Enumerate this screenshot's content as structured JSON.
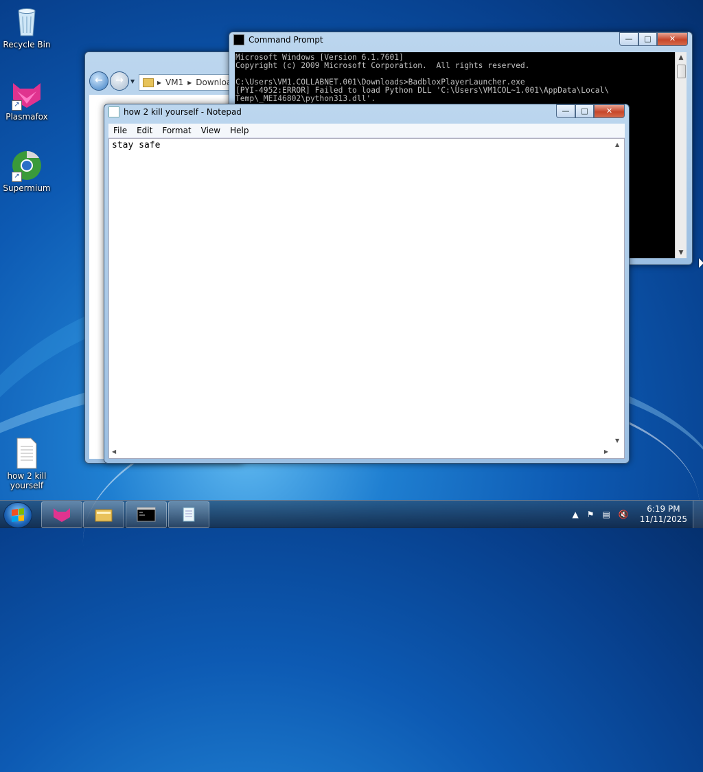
{
  "desktop": {
    "icons": [
      {
        "label": "Recycle Bin",
        "icon": "recycle-bin-icon"
      },
      {
        "label": "Plasmafox",
        "icon": "plasmafox-icon"
      },
      {
        "label": "Supermium",
        "icon": "supermium-icon"
      },
      {
        "label": "how 2 kill yourself",
        "icon": "text-file-icon"
      }
    ]
  },
  "cmd": {
    "title": "Command Prompt",
    "lines": [
      "Microsoft Windows [Version 6.1.7601]",
      "Copyright (c) 2009 Microsoft Corporation.  All rights reserved.",
      "",
      "C:\\Users\\VM1.COLLABNET.001\\Downloads>BadbloxPlayerLauncher.exe",
      "[PYI-4952:ERROR] Failed to load Python DLL 'C:\\Users\\VM1COL~1.001\\AppData\\Local\\",
      "Temp\\_MEI46802\\python313.dll'."
    ]
  },
  "explorer": {
    "breadcrumb": [
      "VM1",
      "Downloa"
    ]
  },
  "notepad": {
    "title": "how 2 kill yourself - Notepad",
    "menu": [
      "File",
      "Edit",
      "Format",
      "View",
      "Help"
    ],
    "content": "stay safe"
  },
  "taskbar": {
    "buttons": [
      "plasmafox-icon",
      "file-explorer-icon",
      "command-prompt-icon",
      "notepad-icon"
    ],
    "clock": {
      "time": "6:19 PM",
      "date": "11/11/2025"
    }
  },
  "colors": {
    "desktop": "#0d5ab3",
    "console_bg": "#000000",
    "console_fg": "#c0c0c0"
  }
}
